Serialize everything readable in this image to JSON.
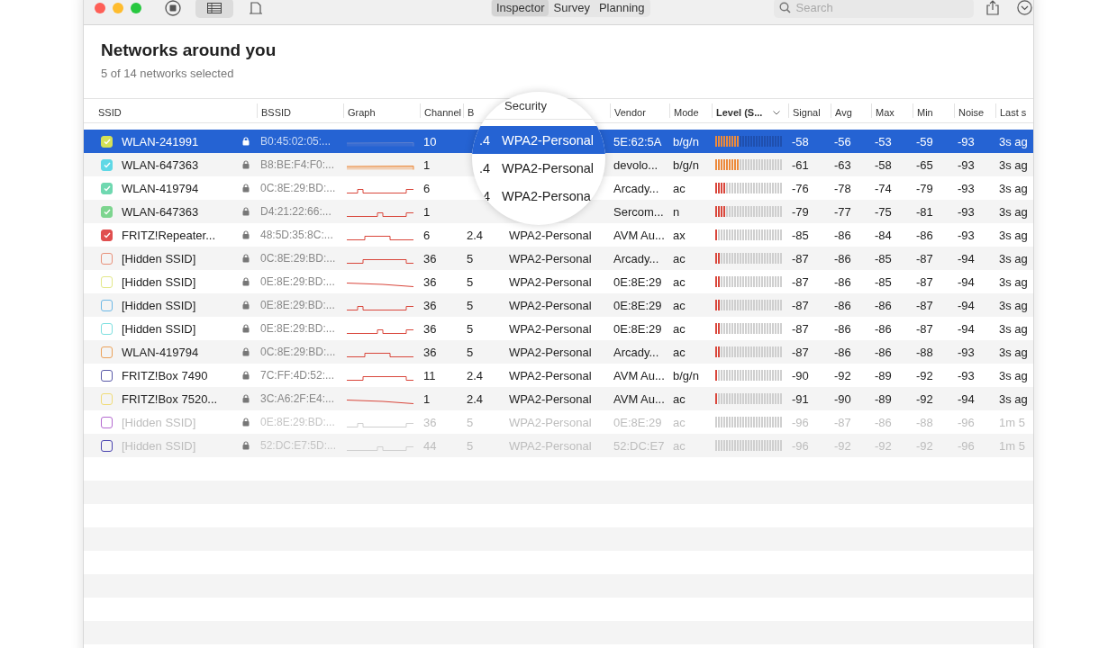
{
  "toolbar": {
    "views": [
      {
        "kind": "table",
        "selected": true
      },
      {
        "kind": "map",
        "selected": false
      }
    ],
    "tabs": [
      {
        "label": "Inspector",
        "selected": true
      },
      {
        "label": "Survey",
        "selected": false
      },
      {
        "label": "Planning",
        "selected": false
      }
    ],
    "search": {
      "placeholder": "Search"
    }
  },
  "title": "Networks around you",
  "subtitle": "5 of 14 networks selected",
  "table": {
    "columns": [
      {
        "label": "SSID",
        "sorted": false
      },
      {
        "label": "BSSID",
        "sorted": false
      },
      {
        "label": "Graph",
        "sorted": false
      },
      {
        "label": "Channel",
        "sorted": false
      },
      {
        "label": "B",
        "sorted": false
      },
      {
        "label": "Vendor",
        "sorted": false
      },
      {
        "label": "Mode",
        "sorted": false
      },
      {
        "label": "Level (S...",
        "sorted": true
      },
      {
        "label": "Signal",
        "sorted": false
      },
      {
        "label": "Avg",
        "sorted": false
      },
      {
        "label": "Max",
        "sorted": false
      },
      {
        "label": "Min",
        "sorted": false
      },
      {
        "label": "Noise",
        "sorted": false
      },
      {
        "label": "Last s",
        "sorted": false
      }
    ],
    "rows": [
      {
        "ssid": "WLAN-241991",
        "checked": true,
        "color": "#d4e157",
        "selected": true,
        "stale": false,
        "bssid": "B0:45:02:05:...",
        "channel": "10",
        "vendor": "5E:62:5A",
        "mode": "b/g/n",
        "level": 0.375,
        "signal": "-58",
        "avg": "-56",
        "max": "-53",
        "min": "-59",
        "noise": "-93",
        "last_seen": "3s ag"
      },
      {
        "ssid": "WLAN-647363",
        "checked": true,
        "color": "#5fd8e6",
        "selected": false,
        "stale": false,
        "bssid": "B8:BE:F4:F0:...",
        "channel": "1",
        "vendor": "devolo...",
        "mode": "b/g/n",
        "level": 0.375,
        "signal": "-61",
        "avg": "-63",
        "max": "-58",
        "min": "-65",
        "noise": "-93",
        "last_seen": "3s ag"
      },
      {
        "ssid": "WLAN-419794",
        "checked": true,
        "color": "#6fd8b0",
        "selected": false,
        "stale": false,
        "bssid": "0C:8E:29:BD:...",
        "channel": "6",
        "vendor": "Arcady...",
        "mode": "ac",
        "level": 0.17,
        "signal": "-76",
        "avg": "-78",
        "max": "-74",
        "min": "-79",
        "noise": "-93",
        "last_seen": "3s ag"
      },
      {
        "ssid": "WLAN-647363",
        "checked": true,
        "color": "#7dd58f",
        "selected": false,
        "stale": false,
        "bssid": "D4:21:22:66:...",
        "channel": "1",
        "vendor": "Sercom...",
        "mode": "n",
        "level": 0.17,
        "signal": "-79",
        "avg": "-77",
        "max": "-75",
        "min": "-81",
        "noise": "-93",
        "last_seen": "3s ag"
      },
      {
        "ssid": "FRITZ!Repeater...",
        "checked": true,
        "color": "#e04f4f",
        "selected": false,
        "stale": false,
        "bssid": "48:5D:35:8C:...",
        "channel": "6",
        "band": "2.4",
        "security": "WPA2-Personal",
        "vendor": "AVM Au...",
        "mode": "ax",
        "level": 0.06,
        "signal": "-85",
        "avg": "-86",
        "max": "-84",
        "min": "-86",
        "noise": "-93",
        "last_seen": "3s ag"
      },
      {
        "ssid": "[Hidden SSID]",
        "checked": false,
        "color": "#e8917a",
        "selected": false,
        "stale": false,
        "bssid": "0C:8E:29:BD:...",
        "channel": "36",
        "band": "5",
        "security": "WPA2-Personal",
        "vendor": "Arcady...",
        "mode": "ac",
        "level": 0.09,
        "signal": "-87",
        "avg": "-86",
        "max": "-85",
        "min": "-87",
        "noise": "-94",
        "last_seen": "3s ag"
      },
      {
        "ssid": "[Hidden SSID]",
        "checked": false,
        "color": "#e3e88a",
        "selected": false,
        "stale": false,
        "bssid": "0E:8E:29:BD:...",
        "channel": "36",
        "band": "5",
        "security": "WPA2-Personal",
        "vendor": "0E:8E:29",
        "mode": "ac",
        "level": 0.09,
        "signal": "-87",
        "avg": "-86",
        "max": "-85",
        "min": "-87",
        "noise": "-94",
        "last_seen": "3s ag"
      },
      {
        "ssid": "[Hidden SSID]",
        "checked": false,
        "color": "#6cb8e6",
        "selected": false,
        "stale": false,
        "bssid": "0E:8E:29:BD:...",
        "channel": "36",
        "band": "5",
        "security": "WPA2-Personal",
        "vendor": "0E:8E:29",
        "mode": "ac",
        "level": 0.09,
        "signal": "-87",
        "avg": "-86",
        "max": "-86",
        "min": "-87",
        "noise": "-94",
        "last_seen": "3s ag"
      },
      {
        "ssid": "[Hidden SSID]",
        "checked": false,
        "color": "#7ee0e0",
        "selected": false,
        "stale": false,
        "bssid": "0E:8E:29:BD:...",
        "channel": "36",
        "band": "5",
        "security": "WPA2-Personal",
        "vendor": "0E:8E:29",
        "mode": "ac",
        "level": 0.09,
        "signal": "-87",
        "avg": "-86",
        "max": "-86",
        "min": "-87",
        "noise": "-94",
        "last_seen": "3s ag"
      },
      {
        "ssid": "WLAN-419794",
        "checked": false,
        "color": "#eba25a",
        "selected": false,
        "stale": false,
        "bssid": "0C:8E:29:BD:...",
        "channel": "36",
        "band": "5",
        "security": "WPA2-Personal",
        "vendor": "Arcady...",
        "mode": "ac",
        "level": 0.09,
        "signal": "-87",
        "avg": "-86",
        "max": "-86",
        "min": "-88",
        "noise": "-93",
        "last_seen": "3s ag"
      },
      {
        "ssid": "FRITZ!Box 7490",
        "checked": false,
        "color": "#5a5aa8",
        "selected": false,
        "stale": false,
        "bssid": "7C:FF:4D:52:...",
        "channel": "11",
        "band": "2.4",
        "security": "WPA2-Personal",
        "vendor": "AVM Au...",
        "mode": "b/g/n",
        "level": 0.05,
        "signal": "-90",
        "avg": "-92",
        "max": "-89",
        "min": "-92",
        "noise": "-93",
        "last_seen": "3s ag"
      },
      {
        "ssid": "FRITZ!Box 7520...",
        "checked": false,
        "color": "#f0dc78",
        "selected": false,
        "stale": false,
        "bssid": "3C:A6:2F:E4:...",
        "channel": "1",
        "band": "2.4",
        "security": "WPA2-Personal",
        "vendor": "AVM Au...",
        "mode": "ac",
        "level": 0.05,
        "signal": "-91",
        "avg": "-90",
        "max": "-89",
        "min": "-92",
        "noise": "-94",
        "last_seen": "3s ag"
      },
      {
        "ssid": "[Hidden SSID]",
        "checked": false,
        "color": "#b46ad0",
        "selected": false,
        "stale": true,
        "bssid": "0E:8E:29:BD:...",
        "channel": "36",
        "band": "5",
        "security": "WPA2-Personal",
        "vendor": "0E:8E:29",
        "mode": "ac",
        "level": 0,
        "signal": "-96",
        "avg": "-87",
        "max": "-86",
        "min": "-88",
        "noise": "-96",
        "last_seen": "1m 5"
      },
      {
        "ssid": "[Hidden SSID]",
        "checked": false,
        "color": "#4a44b0",
        "selected": false,
        "stale": true,
        "bssid": "52:DC:E7:5D:...",
        "channel": "44",
        "band": "5",
        "security": "WPA2-Personal",
        "vendor": "52:DC:E7",
        "mode": "ac",
        "level": 0,
        "signal": "-96",
        "avg": "-92",
        "max": "-92",
        "min": "-92",
        "noise": "-96",
        "last_seen": "1m 5"
      }
    ]
  },
  "magnifier": {
    "header": "Security",
    "rows": [
      {
        "band": ".4",
        "security": "WPA2-Personal",
        "selected": true
      },
      {
        "band": ".4",
        "security": "WPA2-Personal",
        "selected": false
      },
      {
        "band": "4",
        "security": "WPA2-Persona",
        "selected": false
      }
    ]
  }
}
